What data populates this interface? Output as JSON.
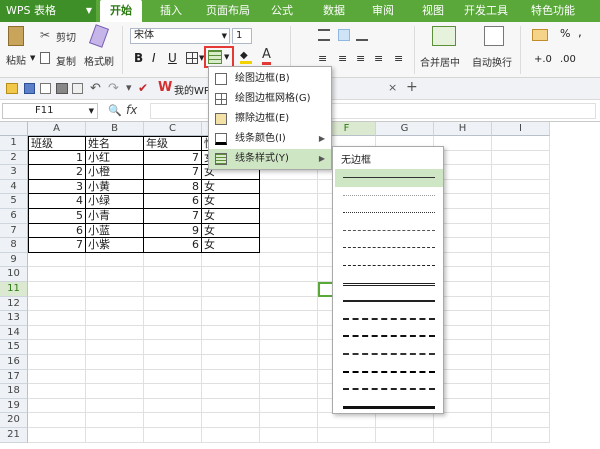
{
  "app": {
    "name": "WPS 表格"
  },
  "tabs": [
    "开始",
    "插入",
    "页面布局",
    "公式",
    "数据",
    "审阅",
    "视图",
    "开发工具",
    "特色功能"
  ],
  "active_tab": "开始",
  "ribbon": {
    "paste": "粘贴",
    "cut": "剪切",
    "copy": "复制",
    "format_painter": "格式刷",
    "font_name": "宋体",
    "font_size": "1",
    "bold": "B",
    "italic": "I",
    "underline": "U",
    "merge_center": "合并居中",
    "wrap_text": "自动换行",
    "percent": "%",
    "comma": ","
  },
  "quick_access": {
    "doc_tab": "我的WPS",
    "new_tab": "+"
  },
  "formula_bar": {
    "name_box": "F11",
    "fx": "fx",
    "value": ""
  },
  "columns": [
    "A",
    "B",
    "C",
    "D",
    "E",
    "F",
    "G",
    "H",
    "I"
  ],
  "rows": [
    "1",
    "2",
    "3",
    "4",
    "5",
    "6",
    "7",
    "8",
    "9",
    "10",
    "11",
    "12",
    "13",
    "14",
    "15",
    "16",
    "17",
    "18",
    "19",
    "20",
    "21"
  ],
  "table": [
    [
      "班级",
      "姓名",
      "年级",
      "性别"
    ],
    [
      "1",
      "小红",
      "7",
      "女"
    ],
    [
      "2",
      "小橙",
      "7",
      "女"
    ],
    [
      "3",
      "小黄",
      "8",
      "女"
    ],
    [
      "4",
      "小绿",
      "6",
      "女"
    ],
    [
      "5",
      "小青",
      "7",
      "女"
    ],
    [
      "6",
      "小蓝",
      "9",
      "女"
    ],
    [
      "7",
      "小紫",
      "6",
      "女"
    ]
  ],
  "border_menu": {
    "items": [
      "绘图边框(B)",
      "绘图边框网格(G)",
      "擦除边框(E)",
      "线条颜色(I)",
      "线条样式(Y)"
    ]
  },
  "line_style_menu": {
    "none_label": "无边框",
    "styles": [
      "thin",
      "hair",
      "dotted",
      "dashed-fine",
      "dash-dot",
      "dash-dot-dot",
      "double",
      "thick",
      "dashed",
      "dash-dot-medium",
      "dash-dot-dot-medium",
      "slant-dash-dot",
      "medium-dash",
      "heavy"
    ]
  },
  "colors": {
    "accent_green": "#5aa83a",
    "highlight": "#cfe6c4",
    "red_box": "#e53935"
  }
}
